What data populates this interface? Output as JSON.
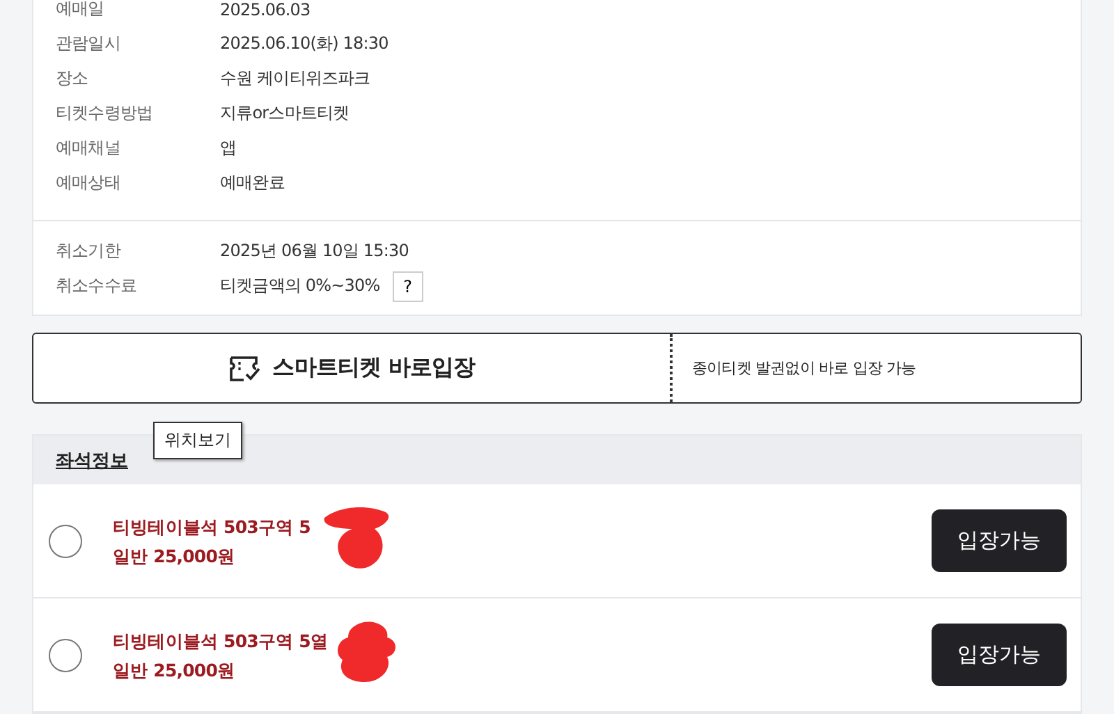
{
  "booking_info": [
    {
      "label": "예매일",
      "value": "2025.06.03"
    },
    {
      "label": "관람일시",
      "value": "2025.06.10(화) 18:30"
    },
    {
      "label": "장소",
      "value": "수원 케이티위즈파크"
    },
    {
      "label": "티켓수령방법",
      "value": "지류or스마트티켓"
    },
    {
      "label": "예매채널",
      "value": "앱"
    },
    {
      "label": "예매상태",
      "value": "예매완료"
    }
  ],
  "cancel_info": [
    {
      "label": "취소기한",
      "value": "2025년 06월 10일 15:30"
    },
    {
      "label": "취소수수료",
      "value": "티켓금액의 0%~30%",
      "help": "?"
    }
  ],
  "smart_ticket": {
    "title": "스마트티켓 바로입장",
    "description": "종이티켓 발권없이 바로 입장 가능"
  },
  "seat_section": {
    "title": "좌석정보",
    "tooltip": "위치보기"
  },
  "seats": [
    {
      "name": "티빙테이블석 503구역 5",
      "price": "일반 25,000원",
      "selected": false,
      "redacted": true,
      "button": "입장가능"
    },
    {
      "name": "티빙테이블석 503구역 5열",
      "price": "일반 25,000원",
      "selected": false,
      "redacted": true,
      "button": "입장가능"
    }
  ]
}
